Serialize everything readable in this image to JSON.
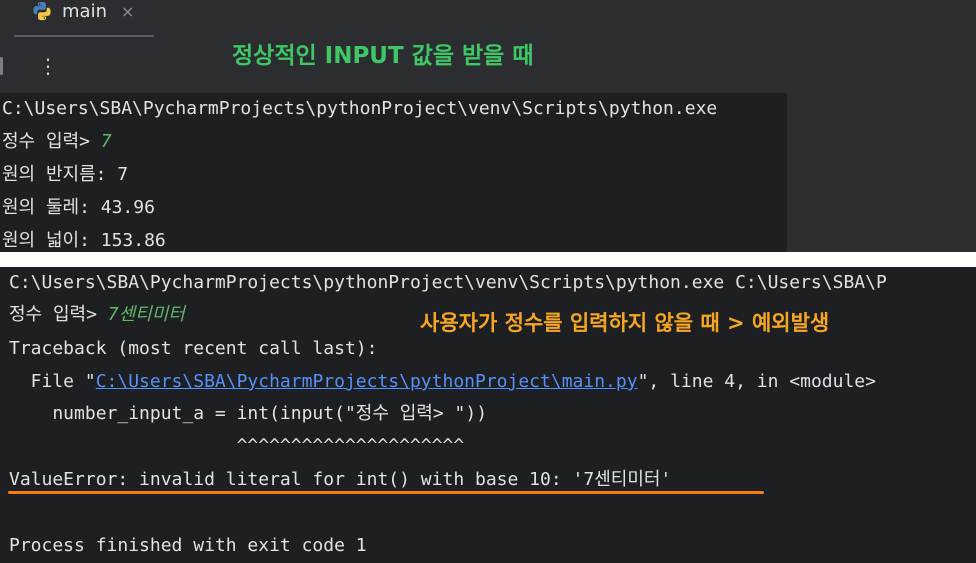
{
  "top_panel": {
    "tab": {
      "icon": "python-icon",
      "label": "main",
      "close": "×"
    },
    "menu_icon": "⋮",
    "annotation": "정상적인 INPUT 값을 받을 때",
    "annotation_color": "#3fc766",
    "console": {
      "path_line": "C:\\Users\\SBA\\PycharmProjects\\pythonProject\\venv\\Scripts\\python.exe",
      "prompt": "정수 입력> ",
      "input_value": "7",
      "lines": [
        "원의 반지름:  7",
        "원의 둘레:  43.96",
        "원의 넓이:  153.86"
      ]
    }
  },
  "bottom_panel": {
    "annotation": "사용자가 정수를 입력하지 않을 때 > 예외발생",
    "annotation_color": "#f5a623",
    "console": {
      "path_line": "C:\\Users\\SBA\\PycharmProjects\\pythonProject\\venv\\Scripts\\python.exe C:\\Users\\SBA\\P",
      "prompt": "정수 입력> ",
      "input_value": "7센티미터",
      "traceback_header": "Traceback (most recent call last):",
      "file_prefix": "  File \"",
      "file_link": "C:\\Users\\SBA\\PycharmProjects\\pythonProject\\main.py",
      "file_suffix": "\", line 4, in <module>",
      "code_line": "    number_input_a = int(input(\"정수 입력> \"))",
      "caret_line": "                     ^^^^^^^^^^^^^^^^^^^^^",
      "error_line": "ValueError: invalid literal for int() with base 10: '7센티미터'",
      "exit_line": "Process finished with exit code 1"
    }
  },
  "colors": {
    "error_red": "#f75464",
    "link_blue": "#5591f7",
    "underline_orange": "#f77d0f",
    "console_bg": "#1e1f22"
  }
}
